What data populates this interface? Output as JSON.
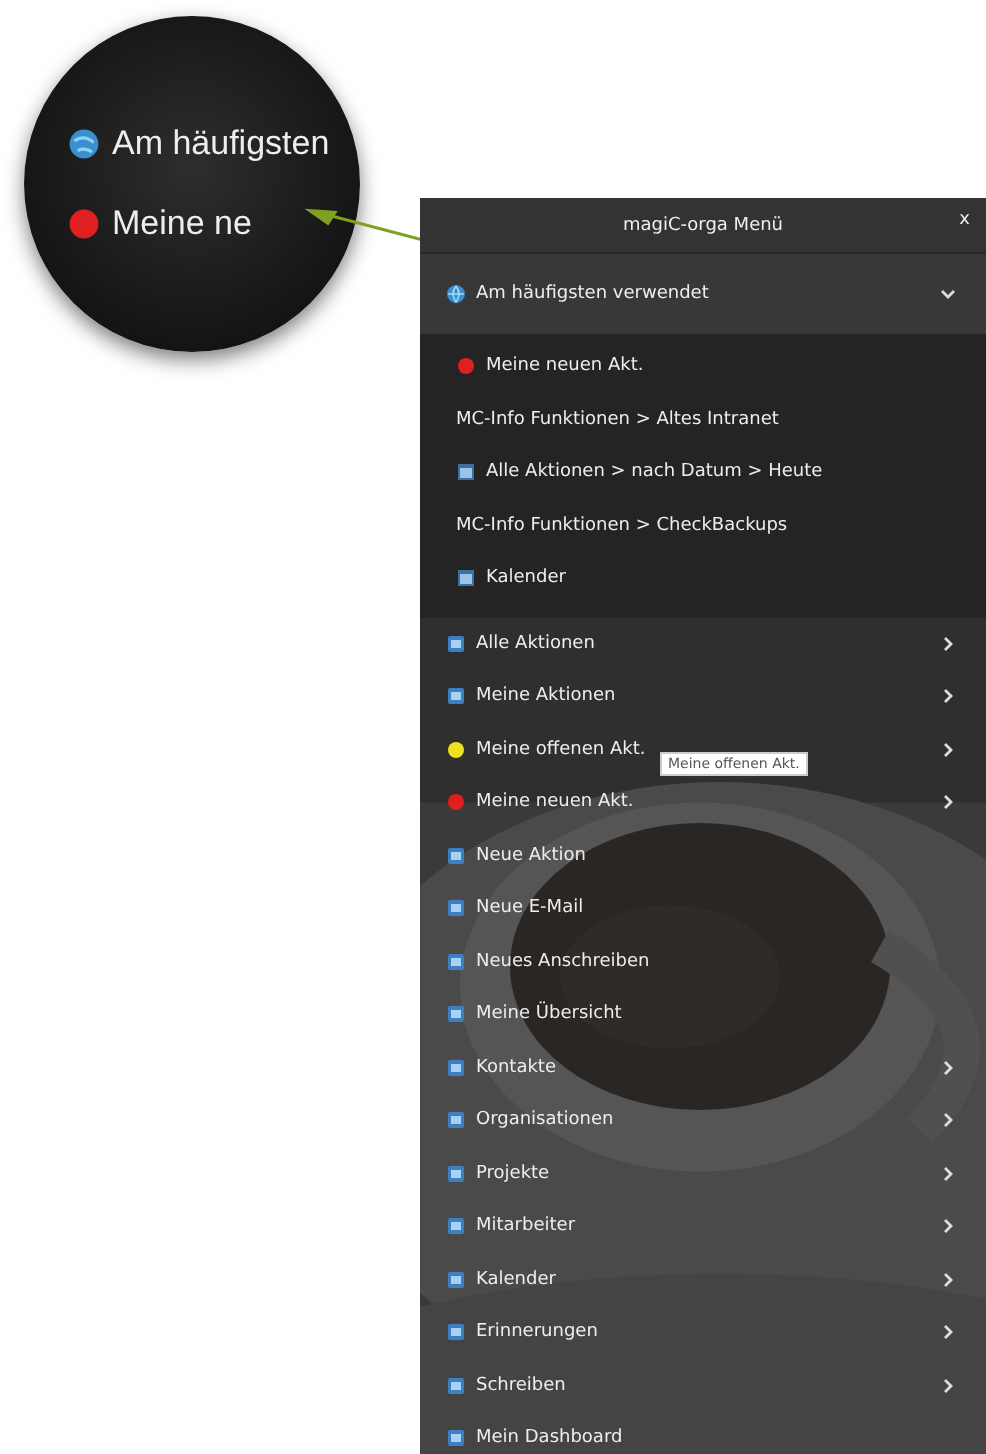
{
  "magnifier": {
    "items": [
      {
        "label": "Am häufigsten",
        "kind": "globe"
      },
      {
        "label": "Meine ne",
        "kind": "dot",
        "color": "#e02020"
      }
    ]
  },
  "window": {
    "title": "magiC-orga Menü",
    "close": "x"
  },
  "section": {
    "label": "Am häufigsten verwendet",
    "expanded": true,
    "items": [
      {
        "label": "Meine neuen Akt.",
        "kind": "dot",
        "color": "#e02020"
      },
      {
        "label": "MC-Info Funktionen > Altes Intranet",
        "kind": "none"
      },
      {
        "label": "Alle Aktionen > nach Datum > Heute",
        "kind": "icon"
      },
      {
        "label": "MC-Info Funktionen > CheckBackups",
        "kind": "none"
      },
      {
        "label": "Kalender",
        "kind": "icon"
      }
    ]
  },
  "menu": [
    {
      "label": "Alle Aktionen",
      "kind": "icon",
      "submenu": true
    },
    {
      "label": "Meine Aktionen",
      "kind": "icon",
      "submenu": true
    },
    {
      "label": "Meine offenen Akt.",
      "kind": "dot",
      "color": "#f0e020",
      "submenu": true,
      "tooltip": "Meine offenen Akt."
    },
    {
      "label": "Meine neuen Akt.",
      "kind": "dot",
      "color": "#e02020",
      "submenu": true
    },
    {
      "label": "Neue Aktion",
      "kind": "icon",
      "submenu": false
    },
    {
      "label": "Neue E-Mail",
      "kind": "icon",
      "submenu": false
    },
    {
      "label": "Neues Anschreiben",
      "kind": "icon",
      "submenu": false
    },
    {
      "label": "Meine Übersicht",
      "kind": "icon",
      "submenu": false
    },
    {
      "label": "Kontakte",
      "kind": "icon",
      "submenu": true
    },
    {
      "label": "Organisationen",
      "kind": "icon",
      "submenu": true
    },
    {
      "label": "Projekte",
      "kind": "icon",
      "submenu": true
    },
    {
      "label": "Mitarbeiter",
      "kind": "icon",
      "submenu": true
    },
    {
      "label": "Kalender",
      "kind": "icon",
      "submenu": true
    },
    {
      "label": "Erinnerungen",
      "kind": "icon",
      "submenu": true
    },
    {
      "label": "Schreiben",
      "kind": "icon",
      "submenu": true
    },
    {
      "label": "Mein Dashboard",
      "kind": "icon",
      "submenu": false
    }
  ]
}
